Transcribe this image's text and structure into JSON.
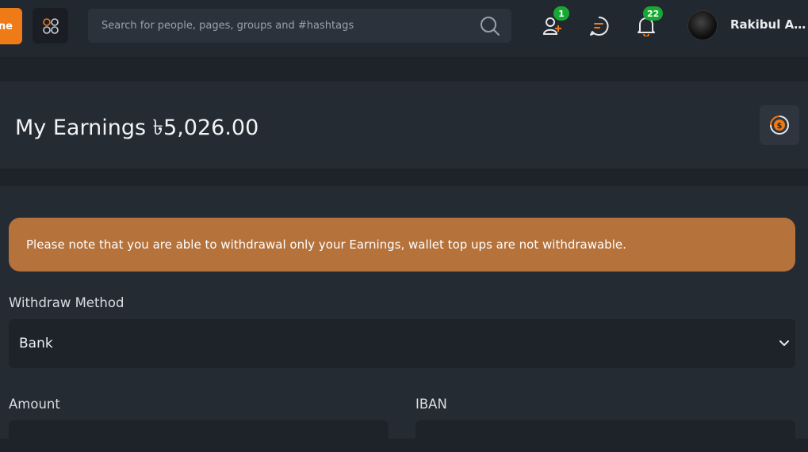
{
  "nav": {
    "logo_text": "ne",
    "search": {
      "placeholder": "Search for people, pages, groups and #hashtags",
      "value": ""
    },
    "friend_requests_badge": "1",
    "notifications_badge": "22",
    "user_name": "Rakibul Ala...",
    "badge_color": "#17a833",
    "accent_color": "#ee7a18"
  },
  "earnings": {
    "title": "My Earnings ৳5,026.00"
  },
  "withdraw": {
    "notice": "Please note that you are able to withdrawal only your Earnings, wallet top ups are not withdrawable.",
    "method_label": "Withdraw Method",
    "method_value": "Bank",
    "amount_label": "Amount",
    "iban_label": "IBAN",
    "notice_color": "#b5723b"
  },
  "icons": {
    "apps": "apps-grid-icon",
    "search": "search-icon",
    "friends": "user-plus-icon",
    "messages": "chat-icon",
    "notifications": "bell-icon",
    "earnings": "dollar-coin-icon",
    "dropdown": "chevron-down-icon"
  }
}
